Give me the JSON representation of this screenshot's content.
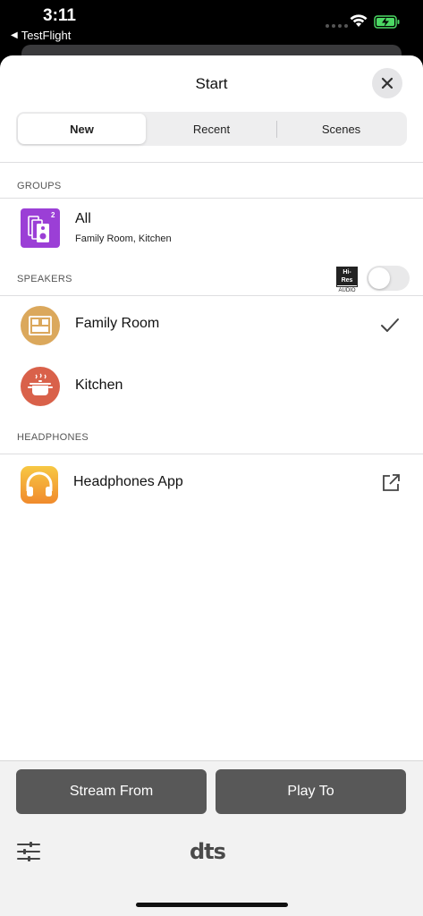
{
  "status_bar": {
    "time": "3:11",
    "back_app": "TestFlight",
    "battery_color": "#4cd964"
  },
  "sheet": {
    "title": "Start",
    "tabs": [
      {
        "label": "New",
        "active": true
      },
      {
        "label": "Recent",
        "active": false
      },
      {
        "label": "Scenes",
        "active": false
      }
    ]
  },
  "groups": {
    "header": "GROUPS",
    "items": [
      {
        "title": "All",
        "subtitle": "Family Room, Kitchen",
        "badge": "2",
        "icon": "speaker-group-icon",
        "color": "#9b3fd6"
      }
    ]
  },
  "speakers": {
    "header": "SPEAKERS",
    "hires_badge": {
      "top": "Hi-Res",
      "bottom": "AUDIO"
    },
    "hires_enabled": false,
    "items": [
      {
        "title": "Family Room",
        "icon": "sofa-icon",
        "color": "#dba85c",
        "selected": true
      },
      {
        "title": "Kitchen",
        "icon": "cooking-pot-icon",
        "color": "#d9614a",
        "selected": false
      }
    ]
  },
  "headphones": {
    "header": "HEADPHONES",
    "items": [
      {
        "title": "Headphones App",
        "icon": "headphones-icon",
        "color": "#f5a623"
      }
    ]
  },
  "bottom": {
    "stream_from": "Stream From",
    "play_to": "Play To",
    "logo": "dts"
  }
}
